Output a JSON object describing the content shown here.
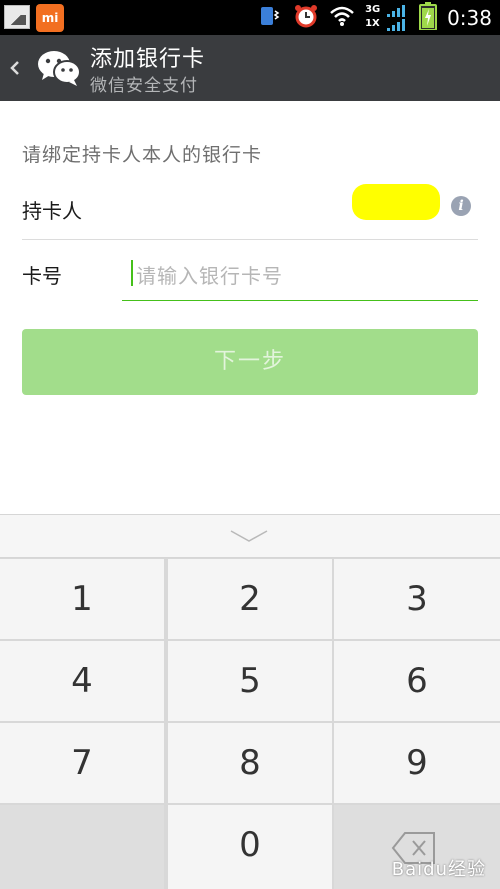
{
  "status_bar": {
    "time": "0:38",
    "network": "3G",
    "network_alt": "1X",
    "icons": [
      "gallery-icon",
      "mi-icon",
      "vibrate-icon",
      "alarm-icon",
      "wifi-icon",
      "signal-icon",
      "battery-charging-icon"
    ]
  },
  "header": {
    "back_icon": "back-chevron-icon",
    "logo_icon": "wechat-logo-icon",
    "title": "添加银行卡",
    "subtitle": "微信安全支付"
  },
  "form": {
    "hint": "请绑定持卡人本人的银行卡",
    "holder_label": "持卡人",
    "card_label": "卡号",
    "card_placeholder": "请输入银行卡号",
    "card_value": ""
  },
  "next_button": {
    "label": "下一步",
    "enabled": false
  },
  "keyboard": {
    "keys": [
      "1",
      "2",
      "3",
      "4",
      "5",
      "6",
      "7",
      "8",
      "9",
      "0"
    ],
    "hide_icon": "chevron-down-icon",
    "backspace_icon": "backspace-icon"
  },
  "watermark": {
    "text": "Baidu经验"
  },
  "colors": {
    "header_bg": "#3a3c3f",
    "accent_green": "#45c01a",
    "button_disabled": "#a2dd8b",
    "redaction": "#ffff00"
  }
}
